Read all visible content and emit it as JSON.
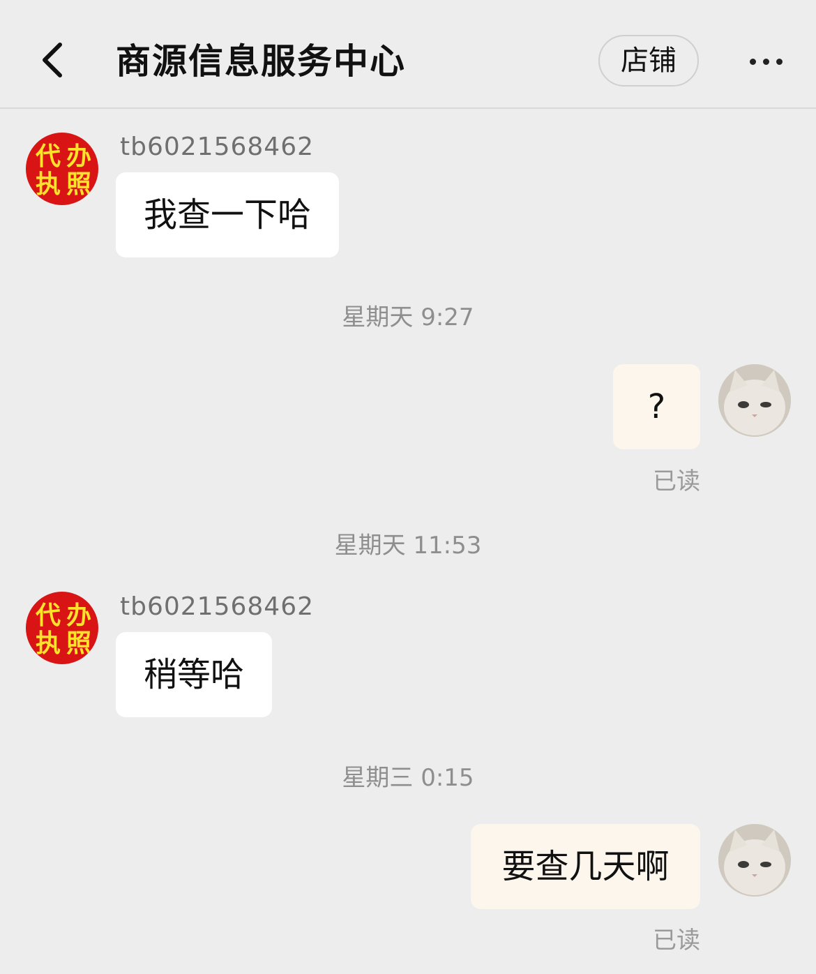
{
  "header": {
    "title": "商源信息服务中心",
    "shop_label": "店铺",
    "back_icon": "chevron-left-icon",
    "more_icon": "more-dots-icon"
  },
  "shop_avatar": {
    "chars": [
      "代",
      "办",
      "执",
      "照"
    ]
  },
  "messages": [
    {
      "direction": "incoming",
      "sender": "tb6021568462",
      "text": "我查一下哈"
    },
    {
      "timestamp": "星期天 9:27"
    },
    {
      "direction": "outgoing",
      "text": "?",
      "status": "已读"
    },
    {
      "timestamp": "星期天 11:53"
    },
    {
      "direction": "incoming",
      "sender": "tb6021568462",
      "text": "稍等哈"
    },
    {
      "timestamp": "星期三 0:15"
    },
    {
      "direction": "outgoing",
      "text": "要查几天啊",
      "status": "已读"
    }
  ],
  "colors": {
    "background": "#ededed",
    "incoming_bubble": "#ffffff",
    "outgoing_bubble": "#fcf6ec",
    "shop_avatar_bg": "#d91414",
    "shop_avatar_text": "#ffe32a"
  }
}
